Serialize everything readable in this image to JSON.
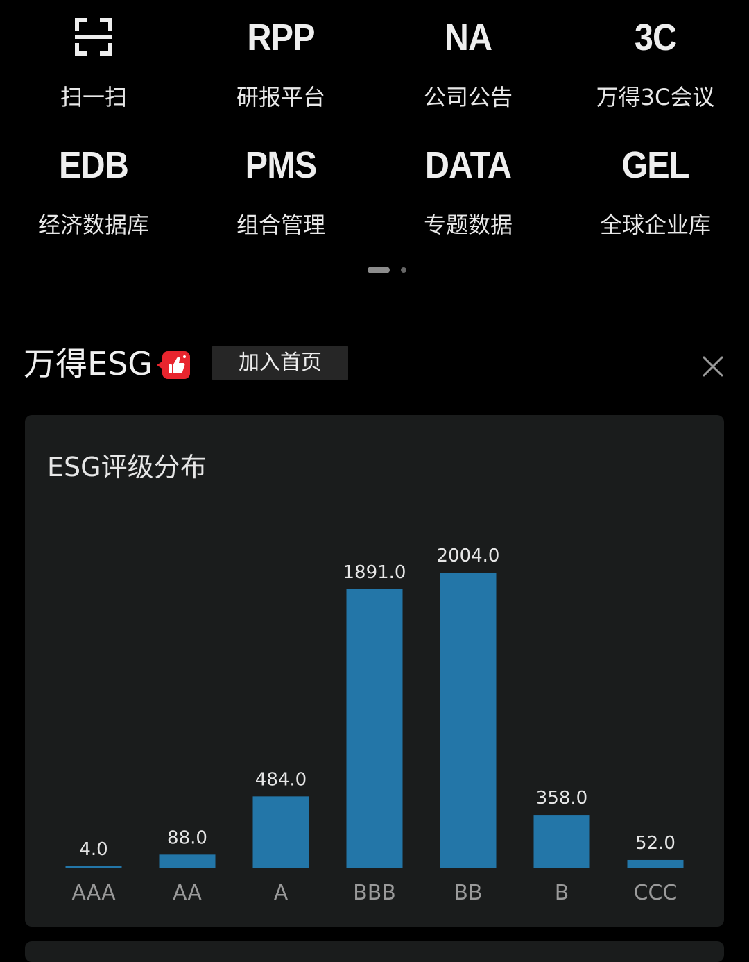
{
  "tiles": [
    {
      "abbr": "",
      "icon": "scan-icon",
      "label": "扫一扫"
    },
    {
      "abbr": "RPP",
      "label": "研报平台"
    },
    {
      "abbr": "NA",
      "label": "公司公告"
    },
    {
      "abbr": "3C",
      "label": "万得3C会议"
    },
    {
      "abbr": "EDB",
      "label": "经济数据库"
    },
    {
      "abbr": "PMS",
      "label": "组合管理"
    },
    {
      "abbr": "DATA",
      "label": "专题数据"
    },
    {
      "abbr": "GEL",
      "label": "全球企业库"
    }
  ],
  "pager": {
    "active_index": 0,
    "count": 2
  },
  "section": {
    "title": "万得ESG",
    "badge_icon": "thumbs-up-icon",
    "add_button": "加入首页",
    "close_icon": "close-icon"
  },
  "colors": {
    "background": "#000000",
    "card": "#1a1c1c",
    "bar": "#2376a8",
    "badge": "#e8252e",
    "button": "#262626"
  },
  "card": {
    "title": "ESG评级分布"
  },
  "chart_data": {
    "type": "bar",
    "title": "ESG评级分布",
    "categories": [
      "AAA",
      "AA",
      "A",
      "BBB",
      "BB",
      "B",
      "CCC"
    ],
    "values": [
      4.0,
      88.0,
      484.0,
      1891.0,
      2004.0,
      358.0,
      52.0
    ],
    "value_labels": [
      "4.0",
      "88.0",
      "484.0",
      "1891.0",
      "2004.0",
      "358.0",
      "52.0"
    ],
    "ylim": [
      0,
      2004
    ],
    "grid": false,
    "legend": "none"
  }
}
